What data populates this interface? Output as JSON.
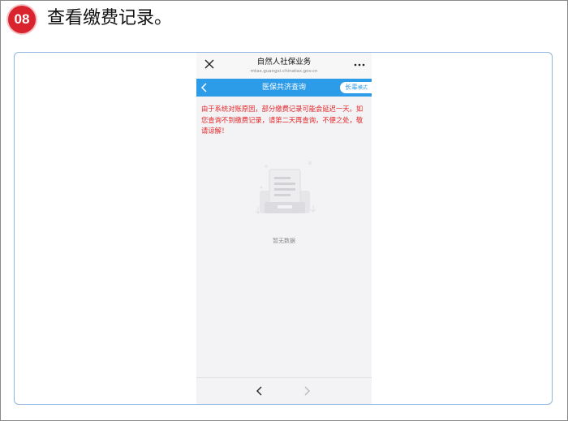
{
  "step": {
    "number": "08",
    "title": "查看缴费记录。"
  },
  "phone": {
    "nav": {
      "close_icon": "close-icon",
      "title": "自然人社保业务",
      "url": "mtax.guangxi.chinatax.gov.cn",
      "more_icon": "more-icon"
    },
    "header": {
      "back_icon": "chevron-left-icon",
      "title": "医保共济查询",
      "mode_big": "长辈",
      "mode_small": "模式"
    },
    "notice": "由于系统对账原因，部分缴费记录可能会延迟一天。如您查询不到缴费记录，请第二天再查询，不便之处，敬请谅解！",
    "empty": {
      "icon": "empty-box-icon",
      "text": "暂无数据"
    },
    "bottom": {
      "prev_icon": "chevron-left-icon",
      "next_icon": "chevron-right-icon"
    }
  },
  "colors": {
    "accent": "#2c9be8",
    "notice": "#e5262a",
    "badge": "#d9232e"
  }
}
